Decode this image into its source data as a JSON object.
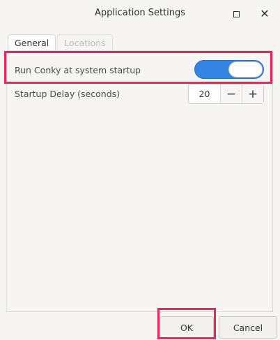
{
  "window": {
    "title": "Application Settings",
    "controls": {
      "maximize_icon": "maximize-icon",
      "close_icon": "close-icon",
      "close_glyph": "✕"
    }
  },
  "tabs": [
    {
      "label": "General",
      "active": true
    },
    {
      "label": "Locations",
      "active": false
    }
  ],
  "settings": {
    "run_at_startup": {
      "label": "Run Conky at system startup",
      "enabled": true
    },
    "startup_delay": {
      "label": "Startup Delay (seconds)",
      "value": "20",
      "minus": "−",
      "plus": "+"
    }
  },
  "footer": {
    "ok_label": "OK",
    "cancel_label": "Cancel"
  },
  "colors": {
    "accent": "#3584e4",
    "highlight": "#e8265e"
  }
}
